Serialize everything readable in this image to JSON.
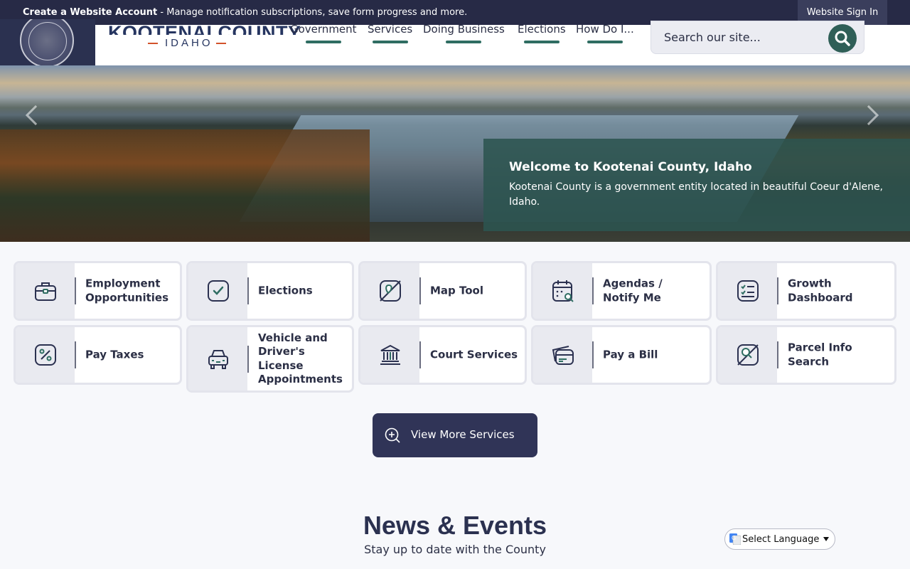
{
  "topbar": {
    "message_bold": "Create a Website Account",
    "message_rest": " - Manage notification subscriptions, save form progress and more.",
    "signin_label": "Website Sign In"
  },
  "logo": {
    "name": "KOOTENAI COUNTY",
    "state": "IDAHO"
  },
  "nav": {
    "items": [
      {
        "label": "Government"
      },
      {
        "label": "Services"
      },
      {
        "label": "Doing Business"
      },
      {
        "label": "Elections"
      },
      {
        "label": "How Do I..."
      }
    ]
  },
  "search": {
    "placeholder": "Search our site..."
  },
  "hero": {
    "title": "Welcome to Kootenai County, Idaho",
    "text": "Kootenai County is a government entity located in beautiful Coeur d'Alene, Idaho."
  },
  "quick_links": [
    {
      "label": "Employment Opportunities",
      "icon": "briefcase-icon"
    },
    {
      "label": "Elections",
      "icon": "checkbox-icon"
    },
    {
      "label": "Map Tool",
      "icon": "map-pin-icon"
    },
    {
      "label": "Agendas / Notify Me",
      "icon": "calendar-search-icon"
    },
    {
      "label": "Growth Dashboard",
      "icon": "checklist-icon"
    },
    {
      "label": "Pay Taxes",
      "icon": "percent-icon"
    },
    {
      "label": "Vehicle and Driver's License Appointments",
      "icon": "car-icon"
    },
    {
      "label": "Court Services",
      "icon": "courthouse-icon"
    },
    {
      "label": "Pay a Bill",
      "icon": "credit-card-icon"
    },
    {
      "label": "Parcel Info Search",
      "icon": "map-search-icon"
    }
  ],
  "more_services": {
    "label": "View More Services"
  },
  "news": {
    "title": "News & Events",
    "subtitle": "Stay up to date with the County"
  },
  "language": {
    "label": "Select Language"
  },
  "colors": {
    "topbar": "#272a46",
    "accent_green": "#2f6d62",
    "hero_card": "#2c5450",
    "button_navy": "#303457"
  }
}
